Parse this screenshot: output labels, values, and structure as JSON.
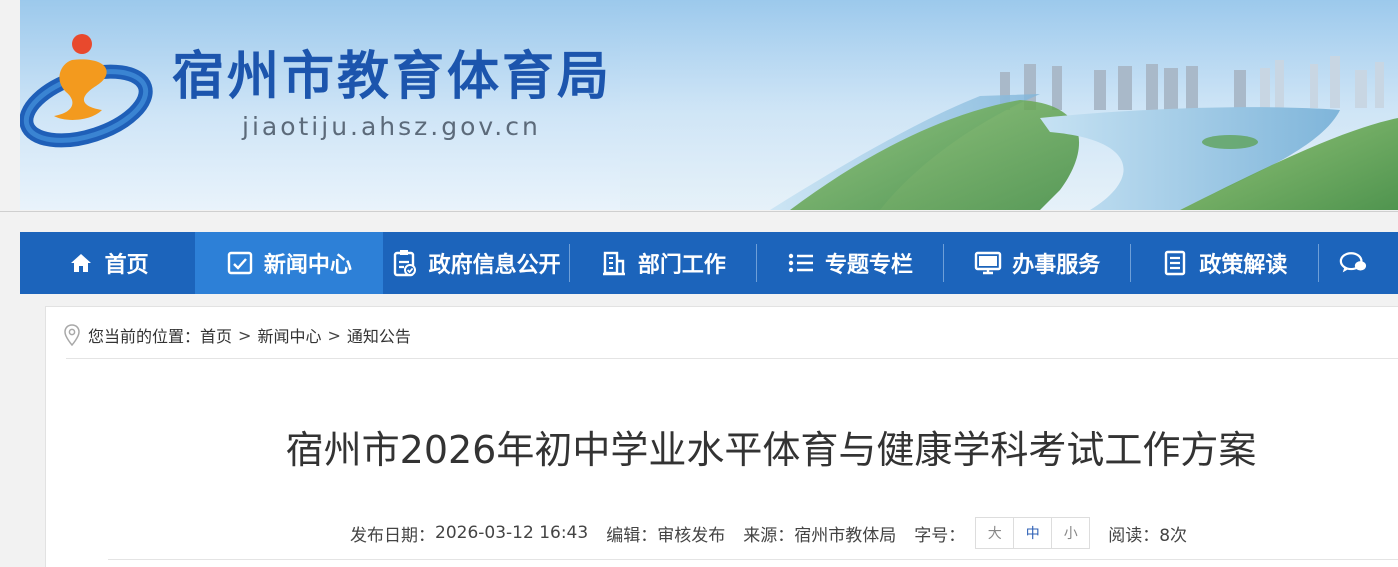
{
  "header": {
    "site_title": "宿州市教育体育局",
    "site_domain": "jiaotiju.ahsz.gov.cn",
    "logo_icon": "bureau-logo-icon"
  },
  "nav": {
    "items": [
      {
        "label": "首页",
        "icon": "home-icon",
        "active": false
      },
      {
        "label": "新闻中心",
        "icon": "news-icon",
        "active": true
      },
      {
        "label": "政府信息公开",
        "icon": "clipboard-check-icon",
        "active": false
      },
      {
        "label": "部门工作",
        "icon": "building-icon",
        "active": false
      },
      {
        "label": "专题专栏",
        "icon": "list-icon",
        "active": false
      },
      {
        "label": "办事服务",
        "icon": "monitor-icon",
        "active": false
      },
      {
        "label": "政策解读",
        "icon": "document-icon",
        "active": false
      },
      {
        "label": "",
        "icon": "chat-icon",
        "active": false
      }
    ]
  },
  "breadcrumb": {
    "prefix": "您当前的位置：",
    "items": [
      "首页",
      "新闻中心",
      "通知公告"
    ],
    "separator": ">"
  },
  "article": {
    "title": "宿州市2026年初中学业水平体育与健康学科考试工作方案",
    "publish_label": "发布日期：",
    "publish_date": "2026-03-12 16:43",
    "editor_label": "编辑：",
    "editor": "审核发布",
    "source_label": "来源：",
    "source": "宿州市教体局",
    "fontsize_label": "字号：",
    "fontsize_options": [
      "大",
      "中",
      "小"
    ],
    "fontsize_selected": "中",
    "reads_label": "阅读：",
    "reads": "8次"
  },
  "colors": {
    "nav_bg": "#1c64bb",
    "nav_active": "#2d80d7",
    "title_blue": "#1c55ad",
    "logo_orange": "#f39a1e"
  }
}
